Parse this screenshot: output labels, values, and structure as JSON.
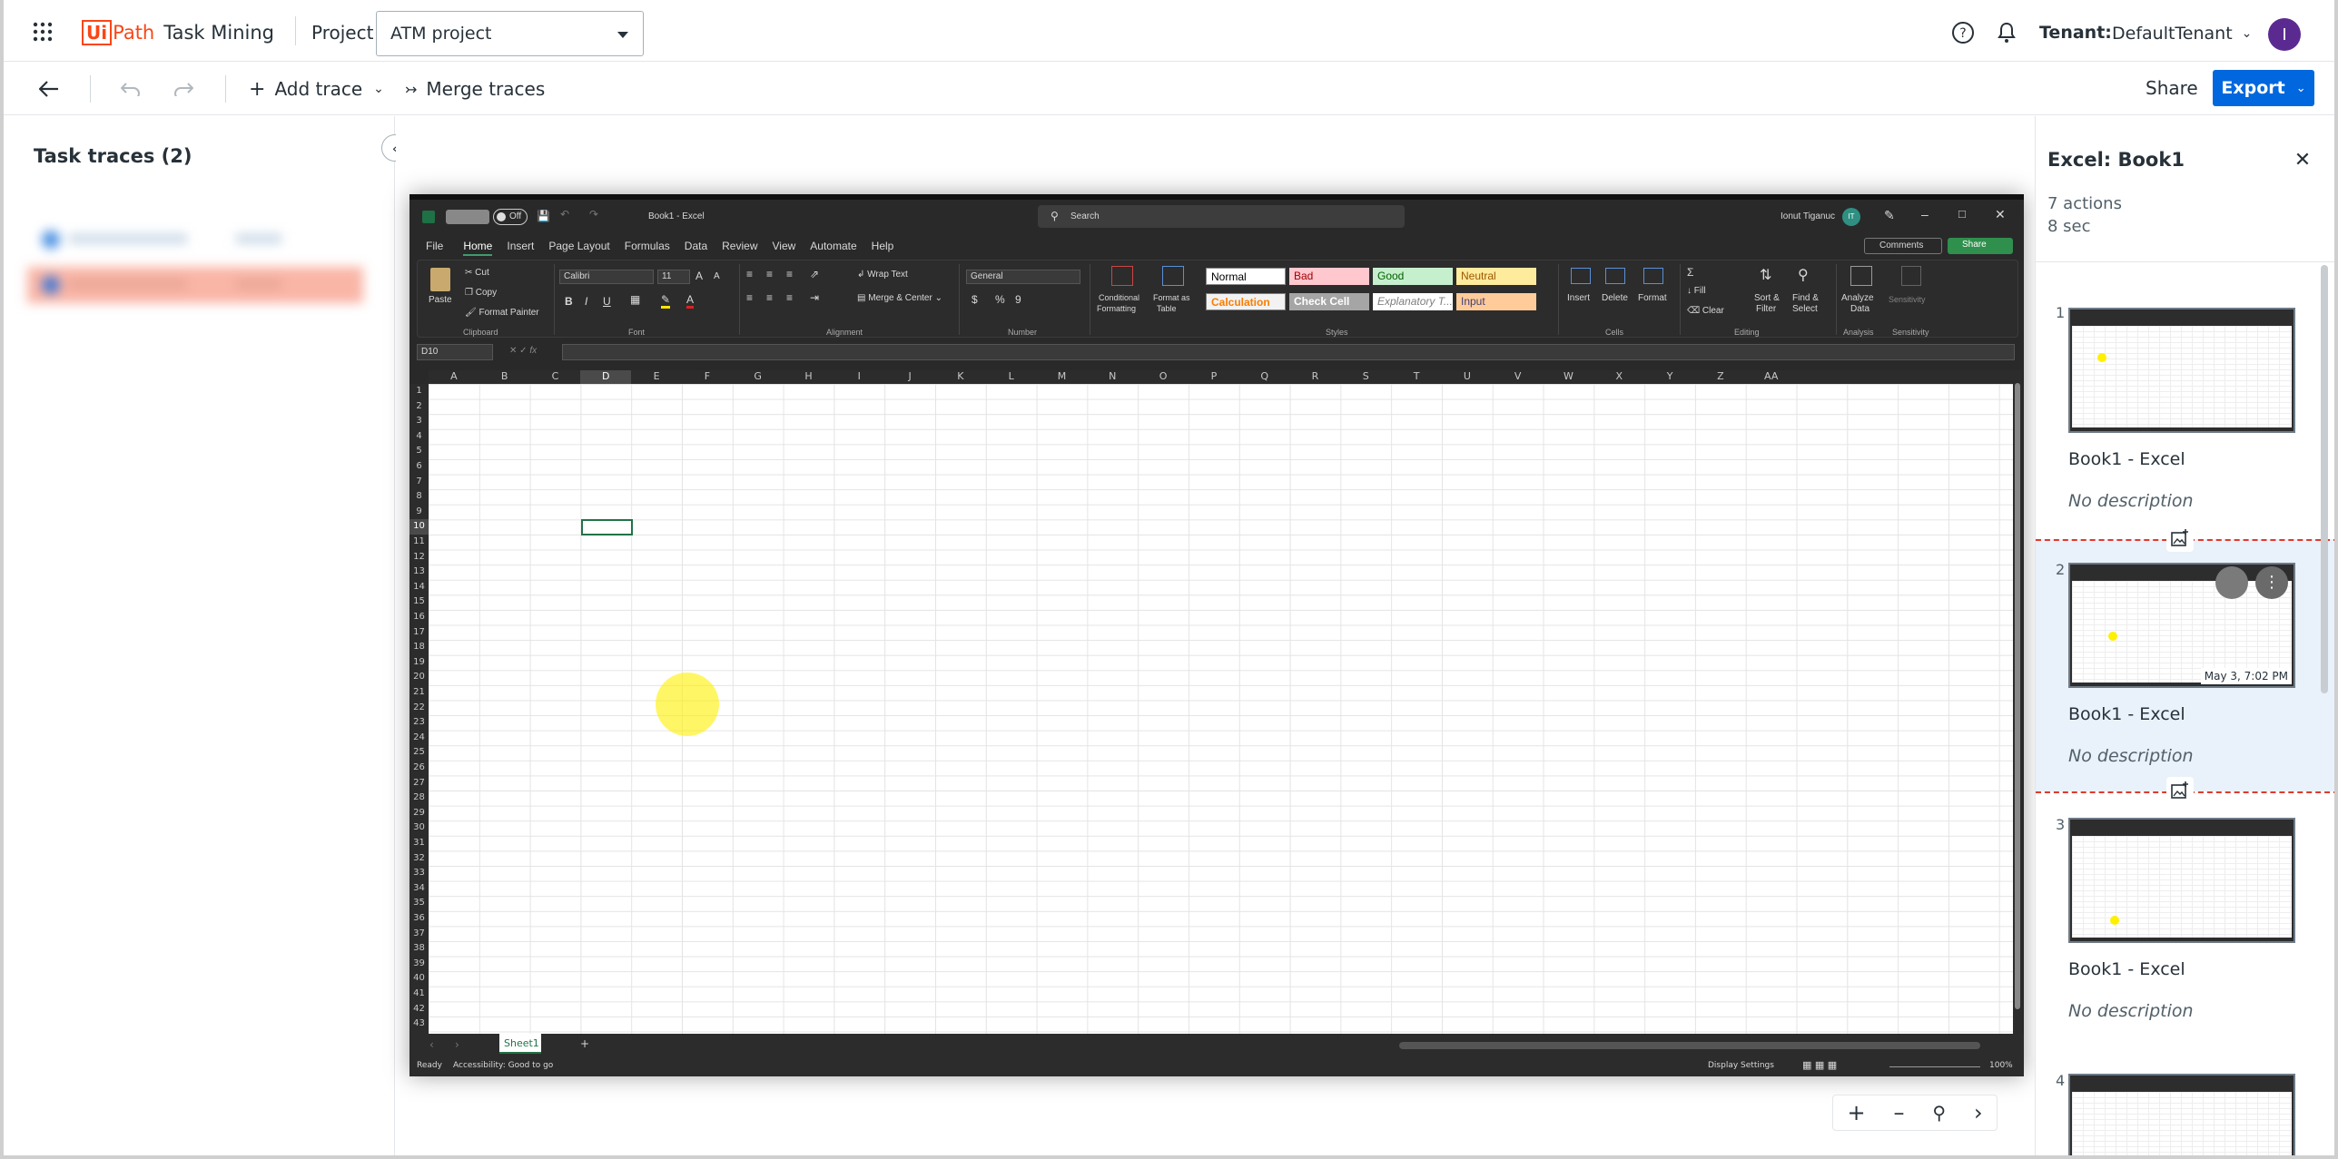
{
  "header": {
    "brand_ui": "Ui",
    "brand_path": "Path",
    "product": "Task Mining",
    "project_label": "Project",
    "project_value": "ATM project",
    "tenant_label": "Tenant:",
    "tenant_value": "DefaultTenant",
    "avatar_initial": "I"
  },
  "toolbar": {
    "add_trace": "Add trace",
    "merge_traces": "Merge traces",
    "share": "Share",
    "export": "Export"
  },
  "left_panel": {
    "title": "Task traces (2)"
  },
  "excel": {
    "title": "Book1  -  Excel",
    "autosave": "Off",
    "search": "Search",
    "user": "Ionut Tiganuc",
    "user_initials": "IT",
    "menu": [
      "File",
      "Home",
      "Insert",
      "Page Layout",
      "Formulas",
      "Data",
      "Review",
      "View",
      "Automate",
      "Help"
    ],
    "comments": "Comments",
    "share": "Share",
    "clipboard": {
      "paste": "Paste",
      "cut": "Cut",
      "copy": "Copy",
      "format_painter": "Format Painter",
      "group": "Clipboard"
    },
    "font": {
      "name": "Calibri",
      "size": "11",
      "group": "Font"
    },
    "alignment": {
      "wrap": "Wrap Text",
      "merge": "Merge & Center",
      "group": "Alignment"
    },
    "number": {
      "format": "General",
      "group": "Number"
    },
    "styles": {
      "cond_fmt_1": "Conditional",
      "cond_fmt_2": "Formatting",
      "fmt_table_1": "Format as",
      "fmt_table_2": "Table",
      "normal": "Normal",
      "bad": "Bad",
      "good": "Good",
      "neutral": "Neutral",
      "calculation": "Calculation",
      "check_cell": "Check Cell",
      "explanatory": "Explanatory T...",
      "input": "Input",
      "group": "Styles"
    },
    "cells": {
      "insert": "Insert",
      "delete": "Delete",
      "format": "Format",
      "group": "Cells"
    },
    "editing": {
      "fill": "Fill",
      "clear": "Clear",
      "sort_1": "Sort &",
      "sort_2": "Filter",
      "find_1": "Find &",
      "find_2": "Select",
      "group": "Editing"
    },
    "analysis": {
      "analyze_1": "Analyze",
      "analyze_2": "Data",
      "group": "Analysis"
    },
    "sensitivity": {
      "label": "Sensitivity",
      "group": "Sensitivity"
    },
    "name_box": "D10",
    "columns": [
      "A",
      "B",
      "C",
      "D",
      "E",
      "F",
      "G",
      "H",
      "I",
      "J",
      "K",
      "L",
      "M",
      "N",
      "O",
      "P",
      "Q",
      "R",
      "S",
      "T",
      "U",
      "V",
      "W",
      "X",
      "Y",
      "Z",
      "AA"
    ],
    "rows": [
      "1",
      "2",
      "3",
      "4",
      "5",
      "6",
      "7",
      "8",
      "9",
      "10",
      "11",
      "12",
      "13",
      "14",
      "15",
      "16",
      "17",
      "18",
      "19",
      "20",
      "21",
      "22",
      "23",
      "24",
      "25",
      "26",
      "27",
      "28",
      "29",
      "30",
      "31",
      "32",
      "33",
      "34",
      "35",
      "36",
      "37",
      "38",
      "39",
      "40",
      "41",
      "42",
      "43"
    ],
    "sheet_tab": "Sheet1",
    "status_ready": "Ready",
    "status_access": "Accessibility: Good to go",
    "display_settings": "Display Settings",
    "zoom": "100%"
  },
  "right_panel": {
    "title": "Excel: Book1",
    "actions": "7 actions",
    "duration": "8 sec",
    "steps": [
      {
        "num": "1",
        "title": "Book1 - Excel",
        "desc": "No description"
      },
      {
        "num": "2",
        "title": "Book1 - Excel",
        "desc": "No description",
        "timestamp": "May 3, 7:02 PM"
      },
      {
        "num": "3",
        "title": "Book1 - Excel",
        "desc": "No description"
      },
      {
        "num": "4"
      }
    ]
  },
  "colors": {
    "brand_orange": "#fa4616",
    "primary_blue": "#0067df",
    "selected_bg": "#e9f1fa",
    "dash_red": "#e0392c",
    "click_marker": "#fff000"
  }
}
